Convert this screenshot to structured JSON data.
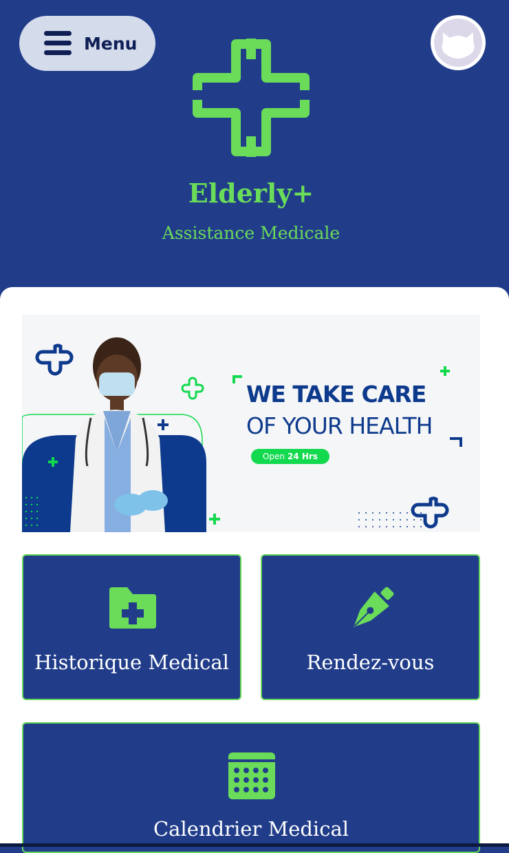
{
  "header": {
    "menu_label": "Menu",
    "brand": "Elderly+",
    "tagline": "Assistance Medicale"
  },
  "banner": {
    "headline_line1": "WE TAKE CARE",
    "headline_line2": "OF YOUR HEALTH",
    "badge_prefix": "Open",
    "badge_hours": "24 Hrs"
  },
  "cards": [
    {
      "label": "Historique Medical",
      "icon": "medical-folder-icon"
    },
    {
      "label": "Rendez-vous",
      "icon": "pen-nib-icon"
    },
    {
      "label": "Calendrier Medical",
      "icon": "calendar-icon"
    }
  ],
  "colors": {
    "primary_blue": "#213d8a",
    "accent_green": "#6bdc5a",
    "menu_bg": "#d4dbea",
    "banner_navy": "#0d3a8c",
    "banner_green": "#12d94e"
  }
}
